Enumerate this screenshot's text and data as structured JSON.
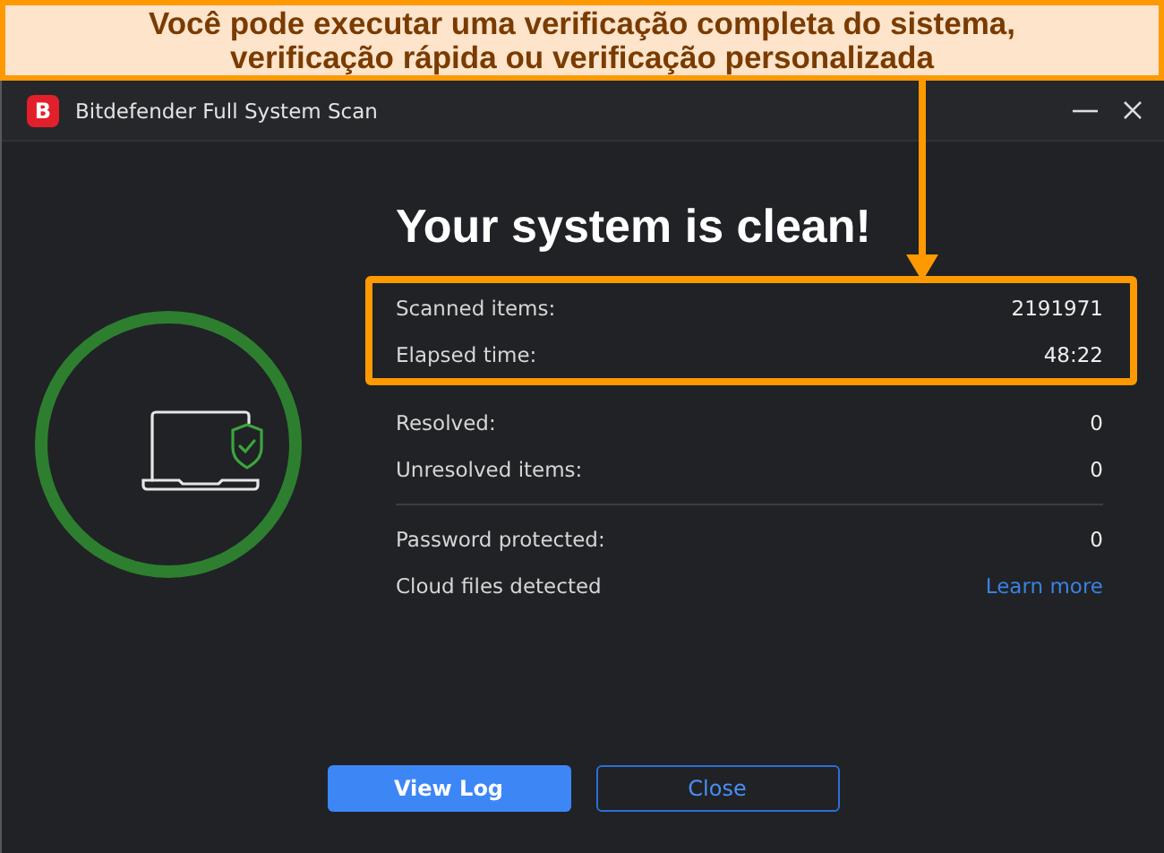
{
  "annotation": {
    "text": "Você pode executar uma verificação completa do sistema, verificação rápida ou verificação personalizada"
  },
  "window": {
    "logo": "B",
    "title": "Bitdefender Full System Scan"
  },
  "status": {
    "kind": "clean",
    "heading": "Your system is clean!"
  },
  "sections": [
    [
      {
        "label": "Scanned items:",
        "value": "2191971",
        "kind": "text",
        "highlighted": true
      },
      {
        "label": "Elapsed time:",
        "value": "48:22",
        "kind": "text",
        "highlighted": true
      },
      {
        "label": "Resolved:",
        "value": "0",
        "kind": "text",
        "highlighted": false
      },
      {
        "label": "Unresolved items:",
        "value": "0",
        "kind": "text",
        "highlighted": false
      }
    ],
    [
      {
        "label": "Password protected:",
        "value": "0",
        "kind": "text",
        "highlighted": false
      },
      {
        "label": "Cloud files detected",
        "value": "Learn more",
        "kind": "link",
        "highlighted": false
      }
    ]
  ],
  "buttons": [
    {
      "label": "View Log",
      "kind": "primary"
    },
    {
      "label": "Close",
      "kind": "secondary"
    }
  ]
}
